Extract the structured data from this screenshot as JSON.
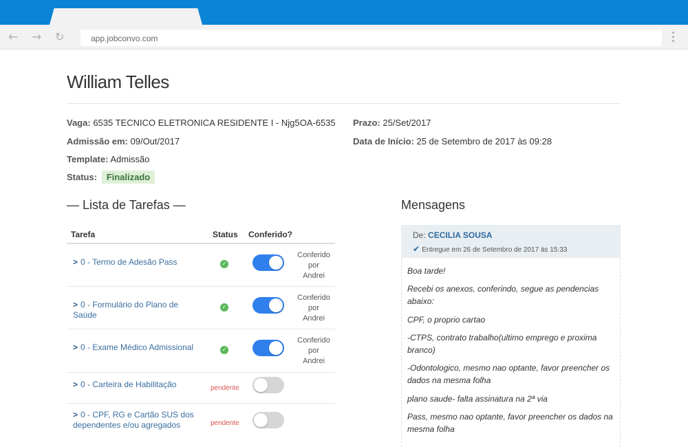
{
  "browser": {
    "url": "app.jobconvo.com",
    "back_icon": "arrow-left",
    "forward_icon": "arrow-right",
    "reload_icon": "reload",
    "accent": "#0a84d6"
  },
  "page": {
    "name": "William Telles",
    "vaga_label": "Vaga:",
    "vaga_value": "6535 TECNICO ELETRONICA RESIDENTE I - Njg5OA-6535",
    "admissao_label": "Admissão em:",
    "admissao_value": "09/Out/2017",
    "template_label": "Template:",
    "template_value": "Admissão",
    "status_label": "Status:",
    "status_value": "Finalizado",
    "prazo_label": "Prazo:",
    "prazo_value": "25/Set/2017",
    "inicio_label": "Data de Início:",
    "inicio_value": "25 de Setembro de 2017 às 09:28"
  },
  "tasks": {
    "title": "— Lista de Tarefas —",
    "col_task": "Tarefa",
    "col_status": "Status",
    "col_checked": "Conferido?",
    "rows": [
      {
        "label": "0 - Termo de Adesão Pass",
        "status": "ok",
        "checked": true,
        "conf_lines": [
          "Conferido",
          "por",
          "Andrei"
        ]
      },
      {
        "label": "0 - Formulário do Plano de Saúde",
        "status": "ok",
        "checked": true,
        "conf_lines": [
          "Conferido",
          "por",
          "Andrei"
        ]
      },
      {
        "label": "0 - Exame Médico Admissional",
        "status": "ok",
        "checked": true,
        "conf_lines": [
          "Conferido",
          "por",
          "Andrei"
        ]
      },
      {
        "label": "0 - Carteira de Habilitação",
        "status": "pendente",
        "checked": false
      },
      {
        "label": "0 - CPF, RG e Cartão SUS dos dependentes e/ou agregados",
        "status": "pendente",
        "checked": false
      }
    ]
  },
  "messages": {
    "title": "Mensagens",
    "from_label": "De:",
    "from_name": "CECILIA SOUSA",
    "delivered": "Entregue em 26 de Setembro de 2017 às 15:33",
    "lines": [
      "Boa tarde!",
      "Recebi os anexos, conferindo, segue as pendencias abaixo:",
      "CPF, o proprio cartao",
      "-CTPS, contrato trabalho(ultimo emprego e proxima branco)",
      "-Odontologico, mesmo nao optante, favor preencher os dados na mesma folha",
      "plano saude- falta assinatura na 2ª via",
      "Pass, mesmo nao optante, favor preencher os dados na mesma folha"
    ]
  }
}
